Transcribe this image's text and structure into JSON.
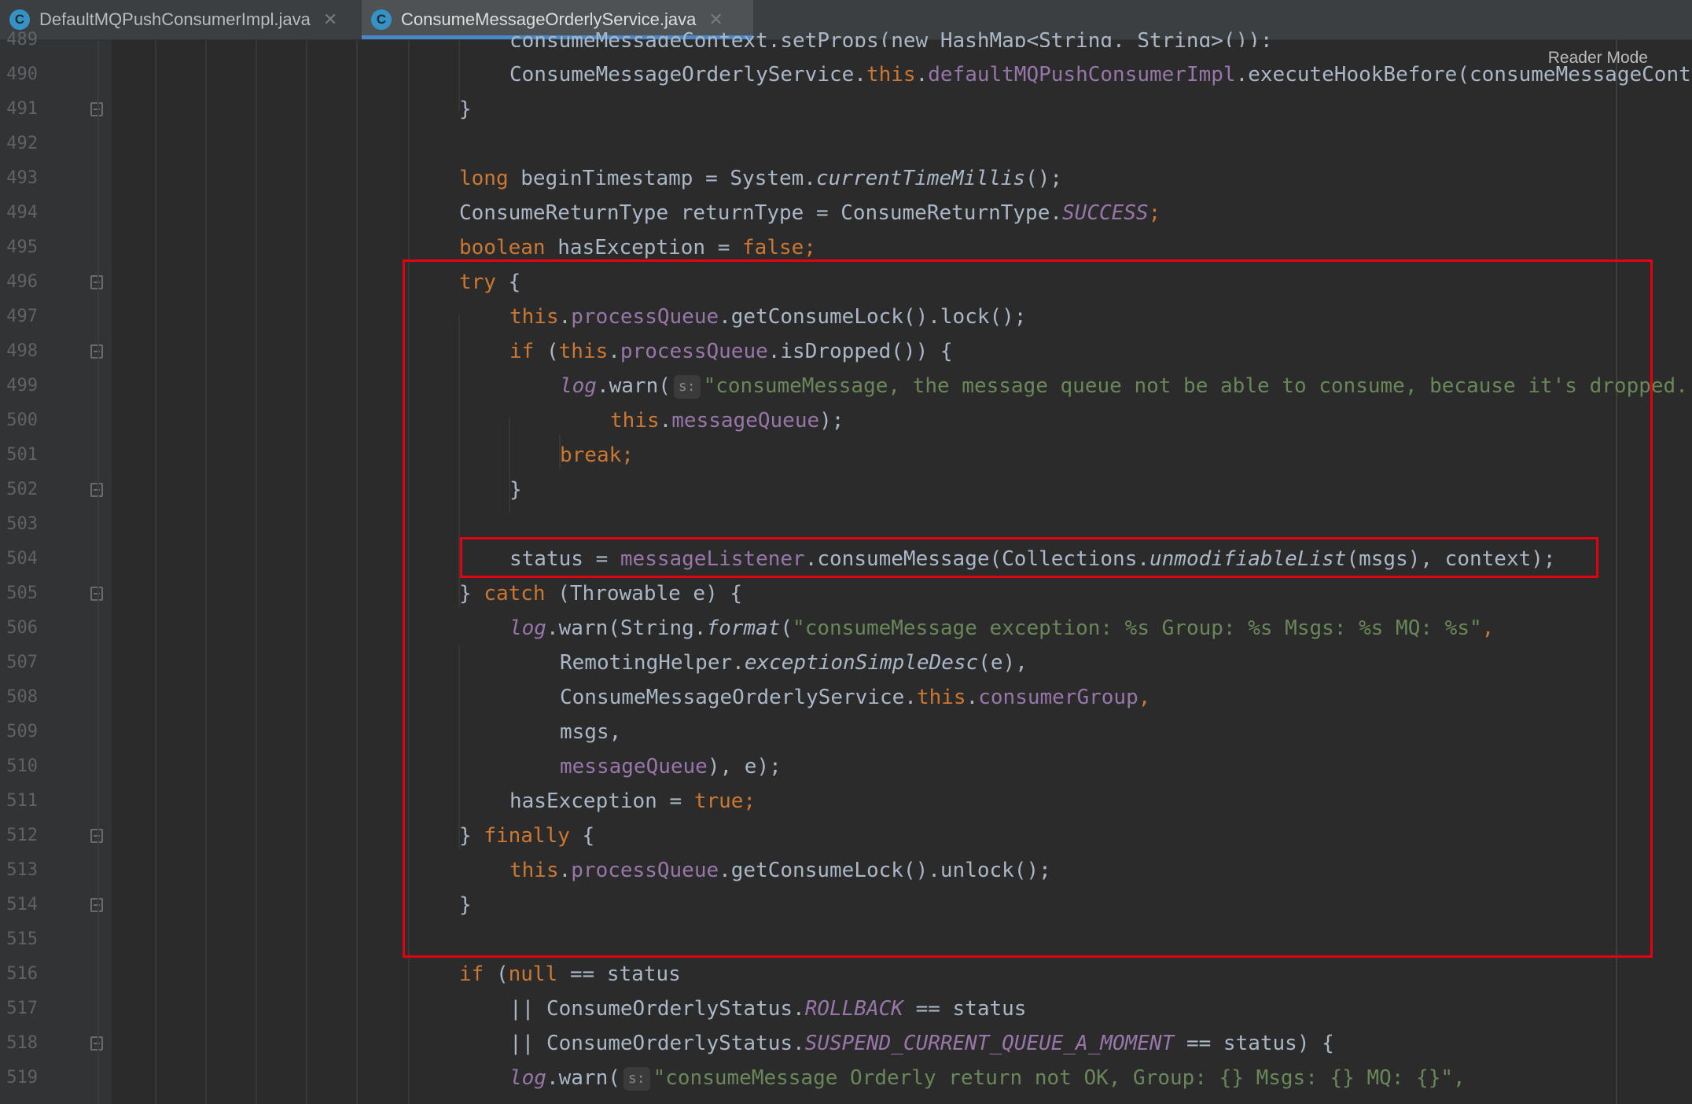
{
  "tabs": [
    {
      "icon": "C",
      "label": "DefaultMQPushConsumerImpl.java",
      "active": false
    },
    {
      "icon": "C",
      "label": "ConsumeMessageOrderlyService.java",
      "active": true
    }
  ],
  "reader_mode_label": "Reader Mode",
  "line_numbers": [
    "489",
    "490",
    "491",
    "492",
    "493",
    "494",
    "495",
    "496",
    "497",
    "498",
    "499",
    "500",
    "501",
    "502",
    "503",
    "504",
    "505",
    "506",
    "507",
    "508",
    "509",
    "510",
    "511",
    "512",
    "513",
    "514",
    "515",
    "516",
    "517",
    "518",
    "519"
  ],
  "code": {
    "l489": "consumeMessageContext.setProps(new HashMap<String, String>());",
    "l490_a": "ConsumeMessageOrderlyService.",
    "l490_b": "this",
    "l490_c": ".",
    "l490_d": "defaultMQPushConsumerImpl",
    "l490_e": ".executeHookBefore(consumeMessageContext);",
    "l491": "}",
    "l493_a": "long",
    "l493_b": " beginTimestamp = System.",
    "l493_c": "currentTimeMillis",
    "l493_d": "();",
    "l494_a": "ConsumeReturnType returnType = ConsumeReturnType.",
    "l494_b": "SUCCESS",
    "l494_c": ";",
    "l495_a": "boolean",
    "l495_b": " hasException = ",
    "l495_c": "false;",
    "l496_a": "try",
    "l496_b": " {",
    "l497_a": "this",
    "l497_b": ".",
    "l497_c": "processQueue",
    "l497_d": ".getConsumeLock().lock();",
    "l498_a": "if",
    "l498_b": " (",
    "l498_c": "this",
    "l498_d": ".",
    "l498_e": "processQueue",
    "l498_f": ".isDropped()) {",
    "l499_a": "log",
    "l499_b": ".warn(",
    "l499_hint": "s:",
    "l499_c": "\"consumeMessage, the message queue not be able to consume, because it's dropped. {}\",",
    "l500_a": "this",
    "l500_b": ".",
    "l500_c": "messageQueue",
    "l500_d": ");",
    "l501": "break;",
    "l502": "}",
    "l504_a": "status = ",
    "l504_b": "messageListener",
    "l504_c": ".consumeMessage(Collections.",
    "l504_d": "unmodifiableList",
    "l504_e": "(msgs), context);",
    "l505_a": "} ",
    "l505_b": "catch",
    "l505_c": " (Throwable e) {",
    "l506_a": "log",
    "l506_b": ".warn(String.",
    "l506_c": "format",
    "l506_d": "(",
    "l506_e": "\"consumeMessage exception: %s Group: %s Msgs: %s MQ: %s\"",
    "l506_f": ",",
    "l507_a": "RemotingHelper.",
    "l507_b": "exceptionSimpleDesc",
    "l507_c": "(e),",
    "l508_a": "ConsumeMessageOrderlyService.",
    "l508_b": "this",
    "l508_c": ".",
    "l508_d": "consumerGroup",
    "l508_e": ",",
    "l509": "msgs,",
    "l510_a": "messageQueue",
    "l510_b": "), e);",
    "l511_a": "hasException = ",
    "l511_b": "true;",
    "l512_a": "} ",
    "l512_b": "finally",
    "l512_c": " {",
    "l513_a": "this",
    "l513_b": ".",
    "l513_c": "processQueue",
    "l513_d": ".getConsumeLock().unlock();",
    "l514": "}",
    "l516_a": "if",
    "l516_b": " (",
    "l516_c": "null",
    "l516_d": " == status",
    "l517_a": "|| ConsumeOrderlyStatus.",
    "l517_b": "ROLLBACK",
    "l517_c": " == status",
    "l518_a": "|| ConsumeOrderlyStatus.",
    "l518_b": "SUSPEND_CURRENT_QUEUE_A_MOMENT",
    "l518_c": " == status) {",
    "l519_a": "log",
    "l519_b": ".warn(",
    "l519_hint": "s:",
    "l519_c": "\"consumeMessage Orderly return not OK, Group: {} Msgs: {} MQ: {}\","
  },
  "colors": {
    "keyword": "#cc7832",
    "field": "#9876aa",
    "string": "#6a8759",
    "default": "#a9b7c6",
    "highlight_box": "#e50012",
    "tab_underline": "#4a88c7"
  }
}
